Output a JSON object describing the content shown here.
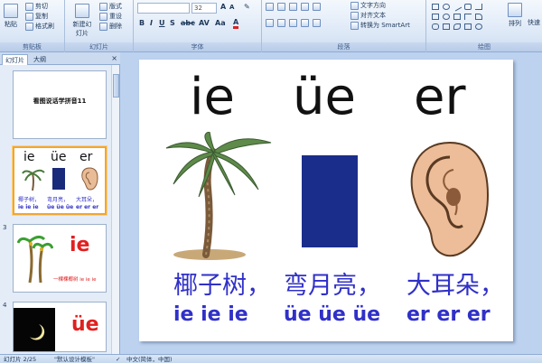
{
  "ribbon": {
    "clipboard": {
      "label": "剪贴板",
      "paste": "粘贴",
      "cut": "剪切",
      "copy": "复制",
      "format_painter": "格式刷"
    },
    "slides": {
      "label": "幻灯片",
      "new_slide": "新建幻灯片",
      "layout": "版式",
      "reset": "重设",
      "delete": "删除"
    },
    "font": {
      "label": "字体",
      "font_name": "",
      "font_size": "32"
    },
    "paragraph": {
      "label": "段落",
      "text_direction": "文字方向",
      "align_text": "对齐文本",
      "smartart": "转换为 SmartArt"
    },
    "drawing": {
      "label": "绘图",
      "arrange": "排列",
      "quick_styles": "快速"
    }
  },
  "pane": {
    "tab_slides": "幻灯片",
    "tab_outline": "大纲",
    "close": "×",
    "thumbs": [
      {
        "num": "",
        "title": "看图说话学拼音11"
      },
      {
        "num": "",
        "py": [
          "ie",
          "üe",
          "er"
        ],
        "cn": [
          "椰子树，",
          "弯月亮，",
          "大耳朵，"
        ],
        "rep": [
          "ie ie ie",
          "üe üe üe",
          "er er er"
        ]
      },
      {
        "num": "3",
        "big": "ie",
        "caption": "一棵棵椰树 ie ie ie"
      },
      {
        "num": "4",
        "big": "üe"
      }
    ]
  },
  "slide": {
    "pinyin": [
      "ie",
      "üe",
      "er"
    ],
    "chinese": [
      "椰子树，",
      "弯月亮，",
      "大耳朵，"
    ],
    "repeat": [
      "ie ie ie",
      "üe üe üe",
      "er er er"
    ]
  },
  "status": {
    "slide_info": "幻灯片 2/25",
    "theme": "\"默认设计模板\"",
    "language": "中文(简体，中国)"
  },
  "colors": {
    "accent_text": "#3030c8",
    "selected_thumb": "#f0a636"
  }
}
